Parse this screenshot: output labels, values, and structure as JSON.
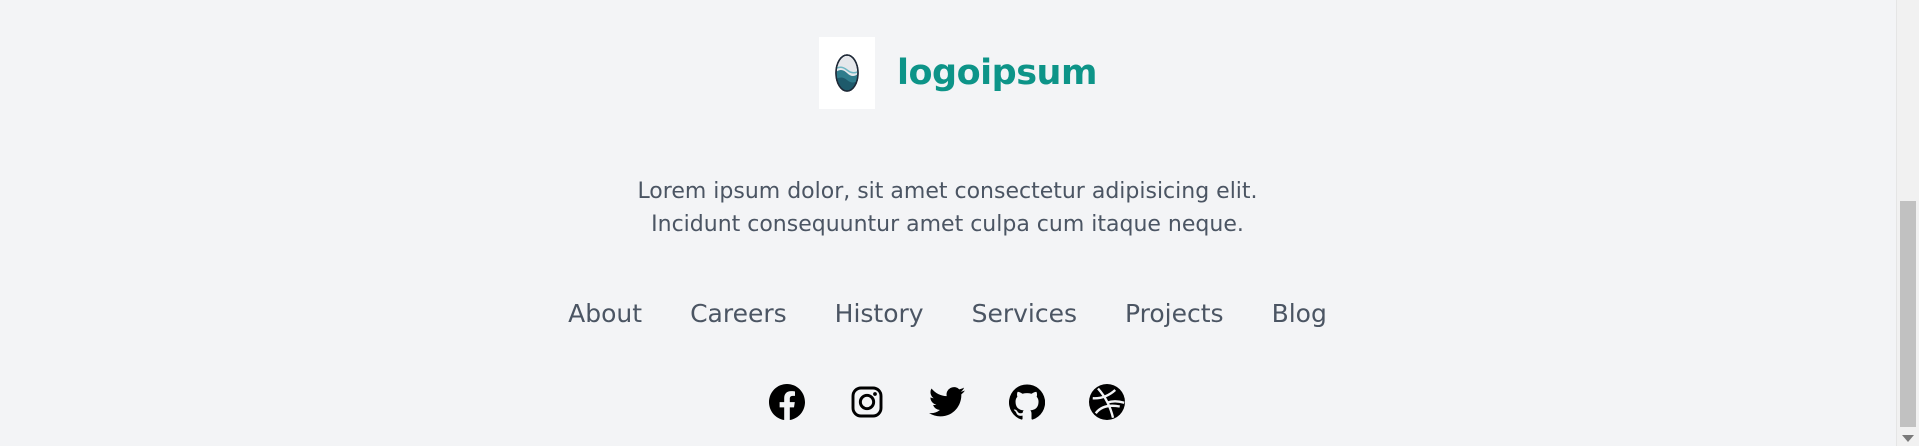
{
  "brand": {
    "name": "logoipsum"
  },
  "tagline": {
    "line1": "Lorem ipsum dolor, sit amet consectetur adipisicing elit.",
    "line2": "Incidunt consequuntur amet culpa cum itaque neque."
  },
  "nav": {
    "items": [
      {
        "label": "About"
      },
      {
        "label": "Careers"
      },
      {
        "label": "History"
      },
      {
        "label": "Services"
      },
      {
        "label": "Projects"
      },
      {
        "label": "Blog"
      }
    ]
  },
  "social": {
    "icons": [
      "facebook-icon",
      "instagram-icon",
      "twitter-icon",
      "github-icon",
      "dribbble-icon"
    ]
  },
  "colors": {
    "background": "#f3f4f6",
    "brand": "#0d9488",
    "text": "#4b5563"
  }
}
